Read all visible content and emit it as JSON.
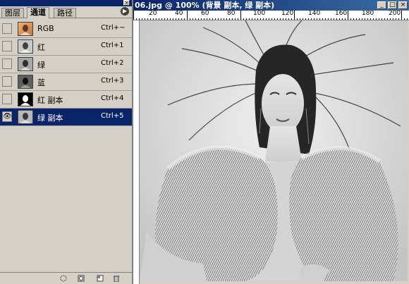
{
  "palette": {
    "tabs": [
      {
        "label": "图层"
      },
      {
        "label": "通道"
      },
      {
        "label": "路径"
      }
    ],
    "menu_icon": "triangle-right-icon",
    "channels": [
      {
        "name": "RGB",
        "shortcut": "Ctrl+~",
        "visible": false,
        "thumb": "color"
      },
      {
        "name": "红",
        "shortcut": "Ctrl+1",
        "visible": false,
        "thumb": "gray"
      },
      {
        "name": "绿",
        "shortcut": "Ctrl+2",
        "visible": false,
        "thumb": "gray"
      },
      {
        "name": "蓝",
        "shortcut": "Ctrl+3",
        "visible": false,
        "thumb": "dark"
      },
      {
        "name": "红 副本",
        "shortcut": "Ctrl+4",
        "visible": false,
        "thumb": "mask"
      },
      {
        "name": "绿 副本",
        "shortcut": "Ctrl+5",
        "visible": true,
        "thumb": "gray",
        "selected": true
      }
    ],
    "bottom_icons": [
      "load-selection-icon",
      "save-selection-icon",
      "new-channel-icon",
      "trash-icon"
    ]
  },
  "document": {
    "title": "06.jpg @ 100% (背景 副本, 绿 副本)",
    "ruler_ticks": [
      "20",
      "40",
      "60",
      "80",
      "100",
      "120",
      "140",
      "160",
      "180",
      "200"
    ]
  },
  "colors": {
    "title_bar": "#0a246a",
    "selected_row": "#0a246a",
    "panel_bg": "#d4d0c8"
  }
}
